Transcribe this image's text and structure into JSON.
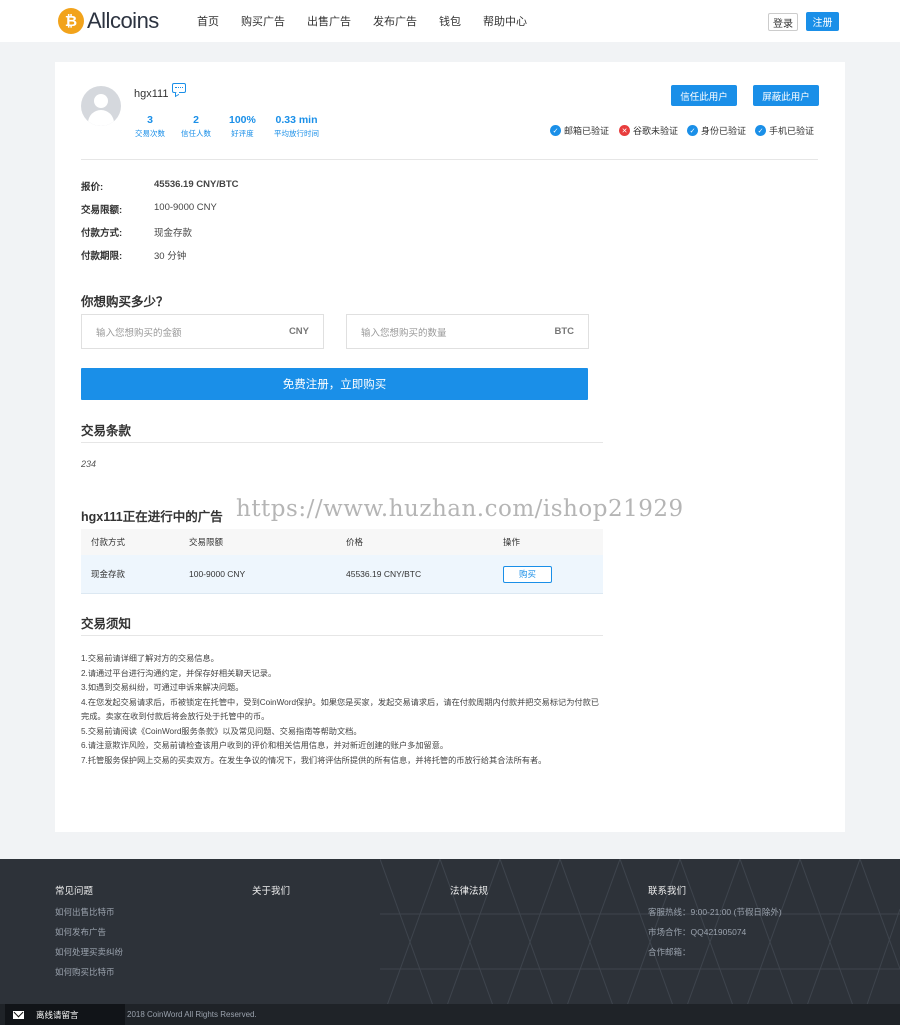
{
  "header": {
    "logo_mark": "₿",
    "logo_text": "Allcoins",
    "nav": [
      "首页",
      "购买广告",
      "出售广告",
      "发布广告",
      "钱包",
      "帮助中心"
    ],
    "login": "登录",
    "register": "注册"
  },
  "profile": {
    "username": "hgx111",
    "stats": [
      {
        "value": "3",
        "label": "交易次数"
      },
      {
        "value": "2",
        "label": "信任人数"
      },
      {
        "value": "100%",
        "label": "好评度"
      },
      {
        "value": "0.33 min",
        "label": "平均放行时间"
      }
    ],
    "trust_button": "信任此用户",
    "block_button": "屏蔽此用户",
    "verifications": [
      {
        "label": "邮箱已验证",
        "status": "ok"
      },
      {
        "label": "谷歌未验证",
        "status": "no"
      },
      {
        "label": "身份已验证",
        "status": "ok"
      },
      {
        "label": "手机已验证",
        "status": "ok"
      }
    ]
  },
  "offer": {
    "price_label": "报价:",
    "price_value": "45536.19 CNY/BTC",
    "limit_label": "交易限额:",
    "limit_value": "100-9000 CNY",
    "payment_label": "付款方式:",
    "payment_value": "现金存款",
    "deadline_label": "付款期限:",
    "deadline_value": "30 分钟"
  },
  "buy_form": {
    "title": "你想购买多少？",
    "amount_placeholder": "输入您想购买的金额",
    "amount_currency": "CNY",
    "qty_placeholder": "输入您想购买的数量",
    "qty_currency": "BTC",
    "submit": "免费注册，立即购买"
  },
  "terms": {
    "title": "交易条款",
    "text": "234"
  },
  "ads": {
    "title": "hgx111正在进行中的广告",
    "columns": [
      "付款方式",
      "交易限额",
      "价格",
      "操作"
    ],
    "rows": [
      {
        "payment": "现金存款",
        "limit": "100-9000 CNY",
        "price": "45536.19 CNY/BTC",
        "action": "购买"
      }
    ]
  },
  "notice": {
    "title": "交易须知",
    "lines": [
      "1.交易前请详细了解对方的交易信息。",
      "2.请通过平台进行沟通约定，并保存好相关聊天记录。",
      "3.如遇到交易纠纷，可通过申诉来解决问题。",
      "4.在您发起交易请求后，币被锁定在托管中，受到CoinWord保护。如果您是买家，发起交易请求后，请在付款周期内付款并把交易标记为付款已完成。卖家在收到付款后将会放行处于托管中的币。",
      "5.交易前请阅读《CoinWord服务条款》以及常见问题、交易指南等帮助文档。",
      "6.请注意欺诈风险，交易前请检查该用户收到的评价和相关信用信息，并对新近创建的账户多加留意。",
      "7.托管服务保护网上交易的买卖双方。在发生争议的情况下，我们将评估所提供的所有信息，并将托管的币放行给其合法所有者。"
    ]
  },
  "footer": {
    "faq_title": "常见问题",
    "faq_items": [
      "如何出售比特币",
      "如何发布广告",
      "如何处理买卖纠纷",
      "如何购买比特币"
    ],
    "about_title": "关于我们",
    "law_title": "法律法规",
    "contact_title": "联系我们",
    "contact_items": [
      "客服热线：9:00-21:00 (节假日除外)",
      "市场合作：QQ421905074",
      "合作邮箱："
    ],
    "copyright": "2018 CoinWord All Rights Reserved.",
    "chat_label": "离线请留言"
  },
  "watermark": "https://www.huzhan.com/ishop21929",
  "colors": {
    "accent": "#1a8fe8",
    "danger": "#e83d3d",
    "footer": "#2d3239"
  }
}
